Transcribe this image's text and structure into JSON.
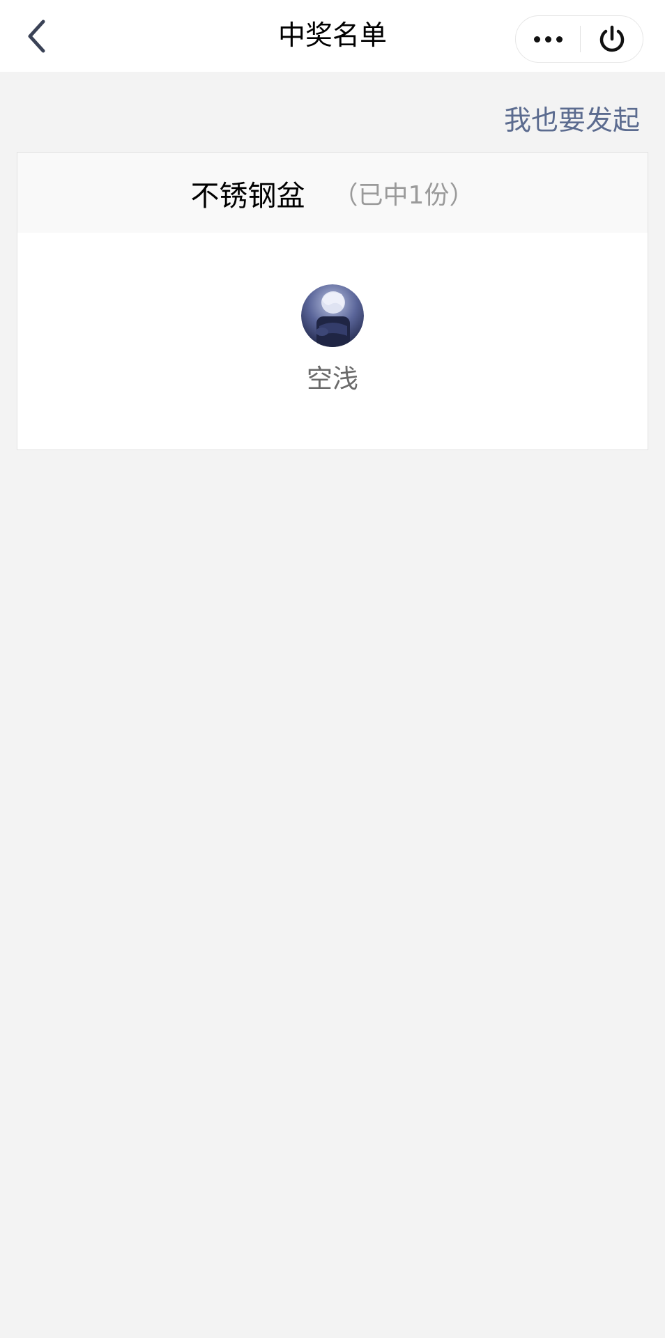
{
  "navbar": {
    "title": "中奖名单",
    "back_icon": "chevron-left-icon",
    "more_icon": "more-dots-icon",
    "close_icon": "power-icon"
  },
  "initiate_link": "我也要发起",
  "prizes": [
    {
      "name": "不锈钢盆",
      "count_text": "（已中1份）",
      "winners": [
        {
          "name": "空浅",
          "avatar": "anime-avatar"
        }
      ]
    }
  ],
  "colors": {
    "link": "#5b6b8f",
    "background": "#f3f3f3",
    "card": "#ffffff",
    "card_header": "#f9f9f9"
  }
}
